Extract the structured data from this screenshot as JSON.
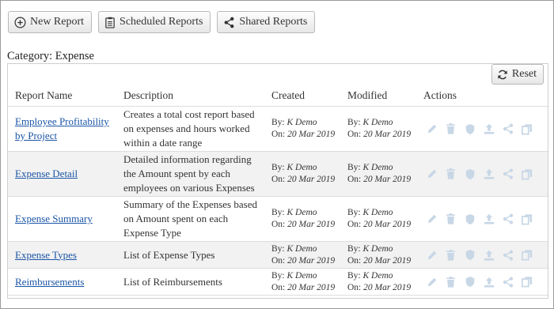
{
  "toolbar": {
    "new_report": "New Report",
    "scheduled_reports": "Scheduled Reports",
    "shared_reports": "Shared Reports"
  },
  "category_label": "Category: Expense",
  "reset_label": "Reset",
  "table": {
    "headers": [
      "Report Name",
      "Description",
      "Created",
      "Modified",
      "Actions"
    ],
    "by_prefix": "By:",
    "on_prefix": "On:",
    "rows": [
      {
        "name": "Employee Profitability by Project",
        "description": "Creates a total cost report based on expenses and hours worked within a date range",
        "created_by": "K Demo",
        "created_on": "20 Mar 2019",
        "modified_by": "K Demo",
        "modified_on": "20 Mar 2019"
      },
      {
        "name": "Expense Detail",
        "description": "Detailed information regarding the Amount spent by each employees on various Expenses",
        "created_by": "K Demo",
        "created_on": "20 Mar 2019",
        "modified_by": "K Demo",
        "modified_on": "20 Mar 2019"
      },
      {
        "name": "Expense Summary",
        "description": "Summary of the Expenses based on Amount spent on each Expense Type",
        "created_by": "K Demo",
        "created_on": "20 Mar 2019",
        "modified_by": "K Demo",
        "modified_on": "20 Mar 2019"
      },
      {
        "name": "Expense Types",
        "description": "List of Expense Types",
        "created_by": "K Demo",
        "created_on": "20 Mar 2019",
        "modified_by": "K Demo",
        "modified_on": "20 Mar 2019"
      },
      {
        "name": "Reimbursements",
        "description": "List of Reimbursements",
        "created_by": "K Demo",
        "created_on": "20 Mar 2019",
        "modified_by": "K Demo",
        "modified_on": "20 Mar 2019"
      }
    ]
  },
  "row_actions": [
    "edit-icon",
    "delete-icon",
    "shield-icon",
    "upload-icon",
    "share-icon",
    "copy-icon"
  ],
  "colors": {
    "link": "#1a55a6",
    "action_icon": "#c8d7e6",
    "alt_row": "#f2f2f2"
  }
}
